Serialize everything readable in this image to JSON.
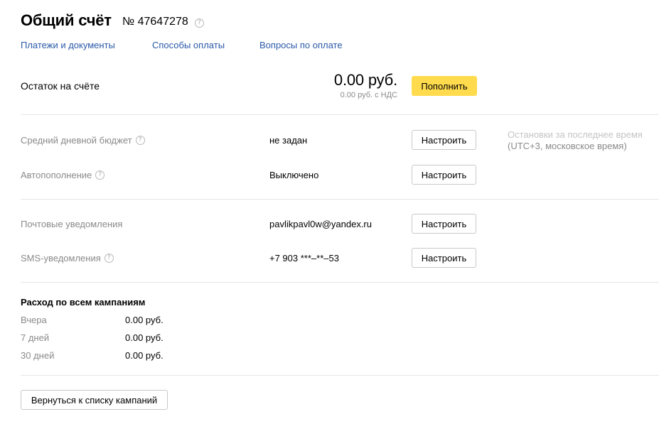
{
  "header": {
    "title": "Общий счёт",
    "account_number": "№ 47647278",
    "help_glyph": "?"
  },
  "tabs": [
    {
      "label": "Платежи и документы"
    },
    {
      "label": "Способы оплаты"
    },
    {
      "label": "Вопросы по оплате"
    }
  ],
  "balance": {
    "label": "Остаток на счёте",
    "amount": "0.00 руб.",
    "amount_vat": "0.00 руб. с НДС",
    "topup_label": "Пополнить"
  },
  "settings": {
    "daily_budget": {
      "label": "Средний дневной бюджет",
      "value": "не задан",
      "button": "Настроить"
    },
    "autopay": {
      "label": "Автопополнение",
      "value": "Выключено",
      "button": "Настроить"
    },
    "email": {
      "label": "Почтовые уведомления",
      "value": "pavlikpavl0w@yandex.ru",
      "button": "Настроить"
    },
    "sms": {
      "label": "SMS-уведомления",
      "value": "+7 903 ***–**–53",
      "button": "Настроить"
    }
  },
  "stops_note": {
    "line1": "Остановки за последнее время",
    "line2": "(UTC+3, московское время)"
  },
  "expenses": {
    "title": "Расход по всем кампаниям",
    "rows": [
      {
        "label": "Вчера",
        "value": "0.00 руб."
      },
      {
        "label": "7 дней",
        "value": "0.00 руб."
      },
      {
        "label": "30 дней",
        "value": "0.00 руб."
      }
    ]
  },
  "footer": {
    "back_label": "Вернуться к списку кампаний"
  },
  "colors": {
    "accent_yellow": "#ffdb4d",
    "link_blue": "#2b5aa8",
    "muted_text": "#8a8a8a",
    "divider": "#e5e5e5"
  }
}
